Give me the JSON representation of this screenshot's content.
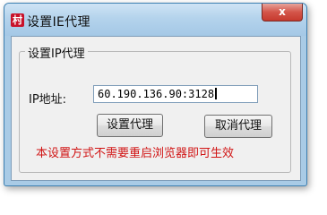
{
  "window": {
    "title": "设置IE代理",
    "app_icon_glyph": "村",
    "close_glyph": "x"
  },
  "group": {
    "title": "设置IP代理",
    "ip_label": "IP地址:",
    "ip_value": "60.190.136.90:3128"
  },
  "buttons": {
    "set_label": "设置代理",
    "cancel_label": "取消代理"
  },
  "note": "本设置方式不需要重启浏览器即可生效",
  "colors": {
    "title_bar": "#b4d3ec",
    "close_button": "#d4554a",
    "note_text": "#d11414",
    "app_icon": "#c8122a"
  },
  "icons": {
    "app": "app-icon",
    "close": "close-icon"
  }
}
